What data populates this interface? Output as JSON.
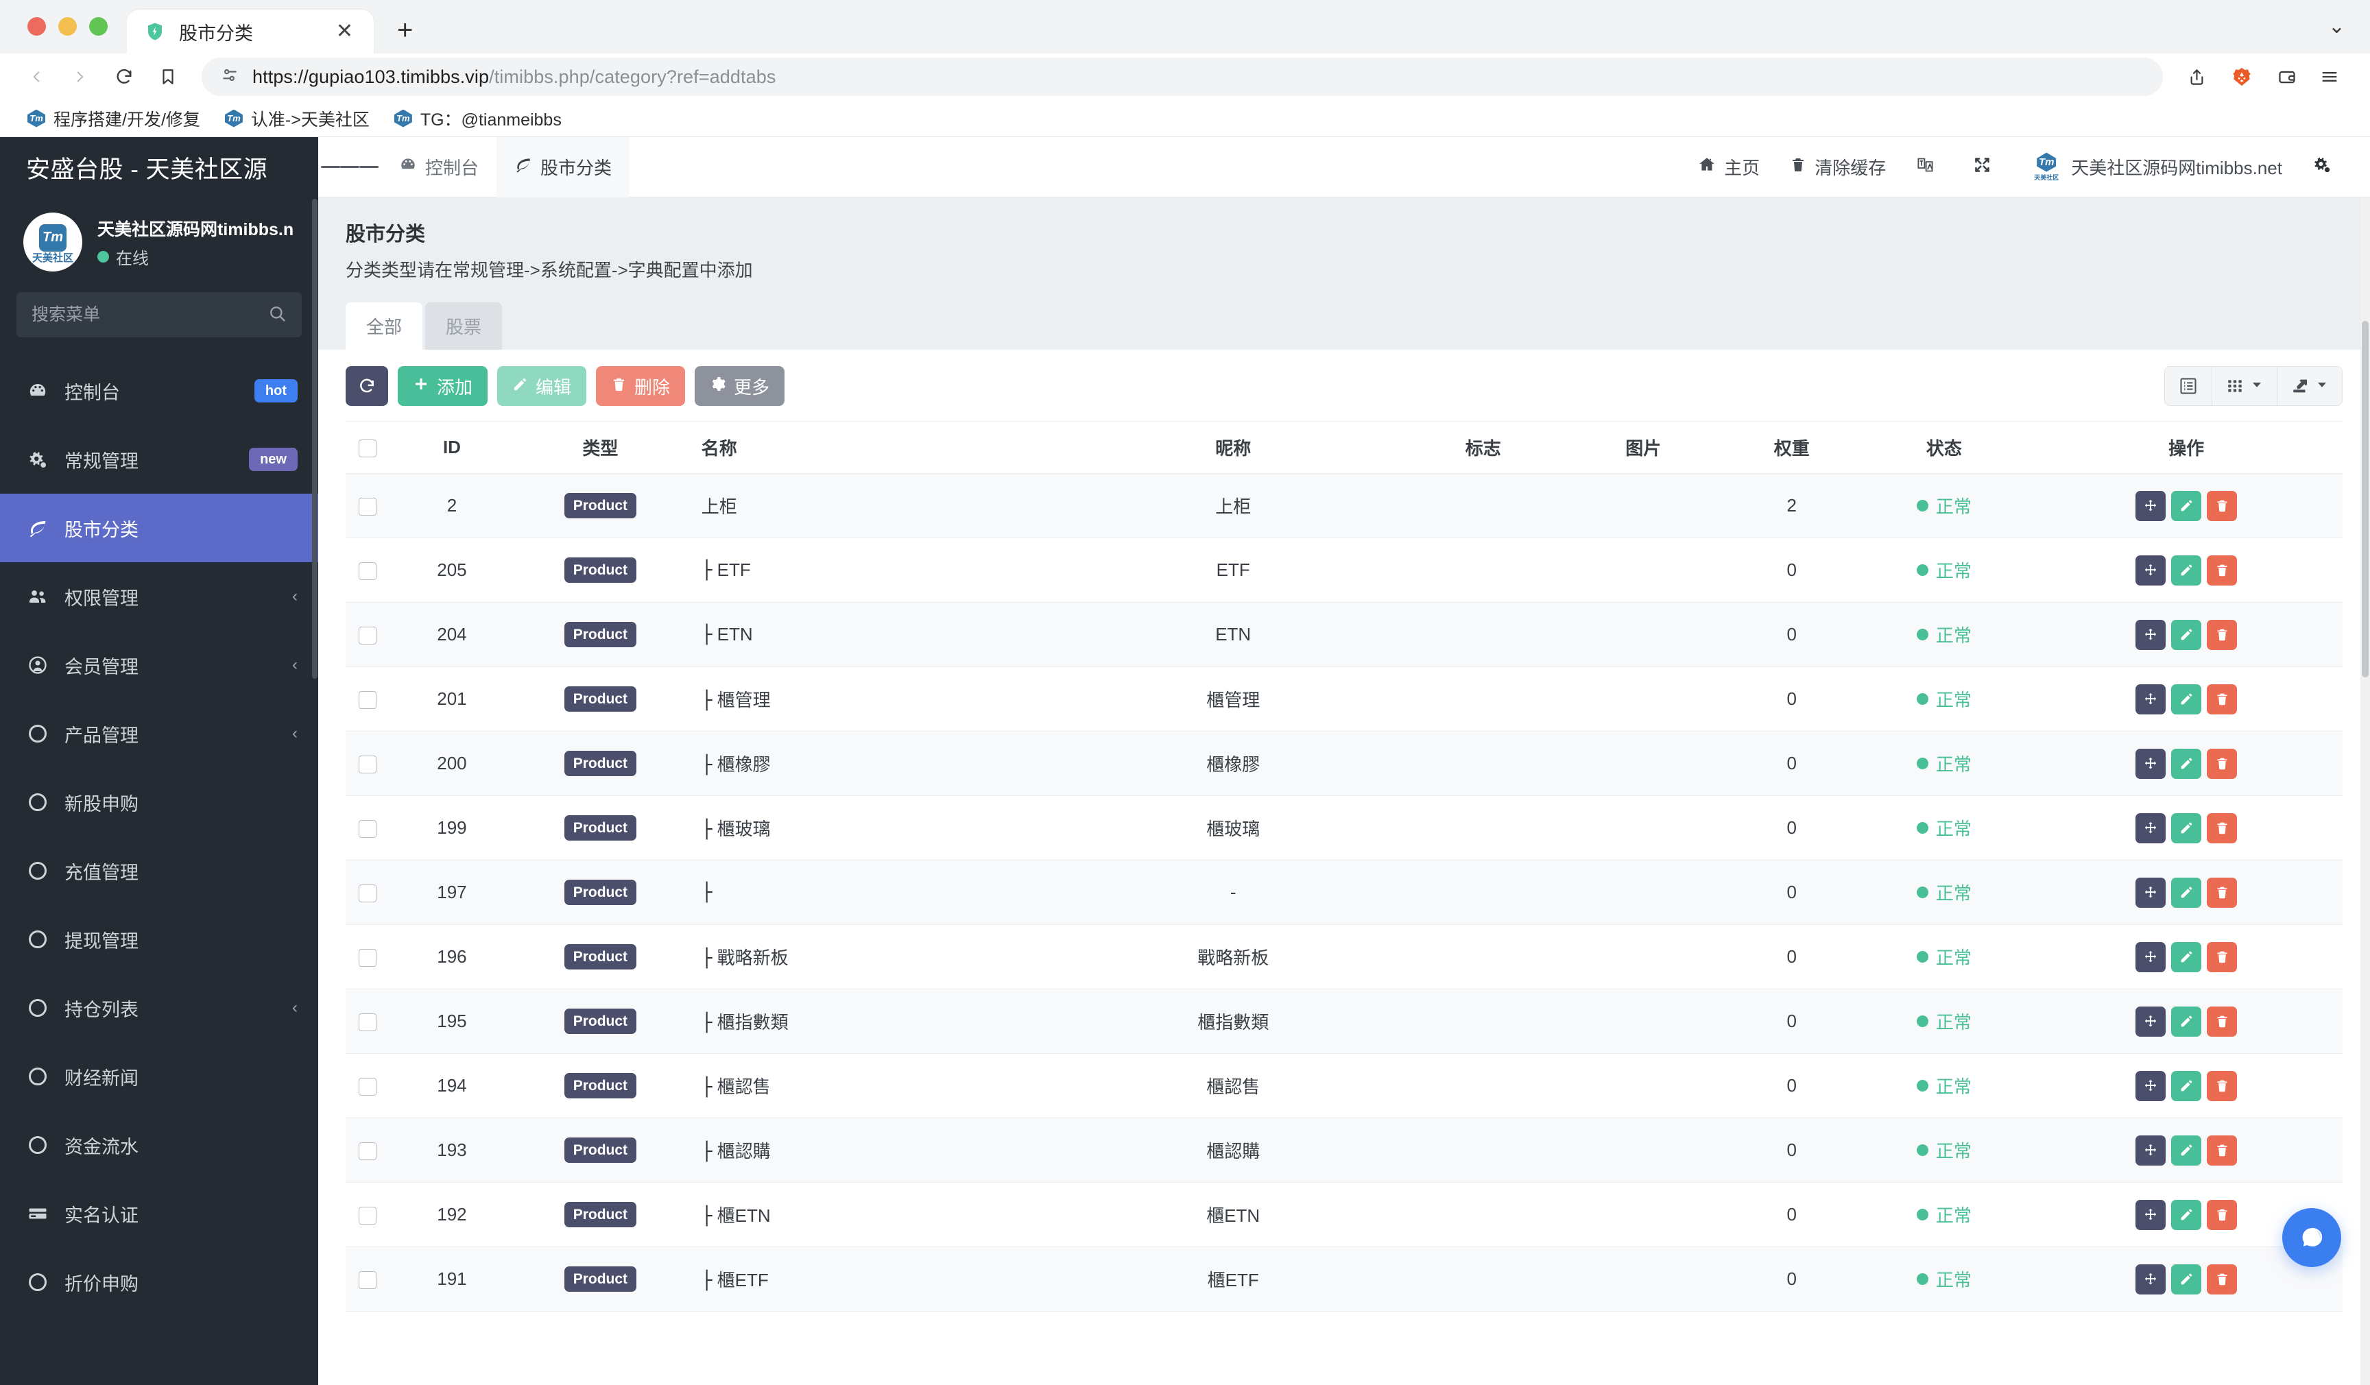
{
  "browser": {
    "tab": {
      "title": "股市分类",
      "favicon": "brave-shield-icon",
      "close_label": "✕"
    },
    "new_tab_label": "+",
    "url_scheme_host": "https://gupiao103.timibbs.vip",
    "url_path": "/timibbs.php/category?ref=addtabs",
    "url_full": "https://gupiao103.timibbs.vip/timibbs.php/category?ref=addtabs",
    "bookmarks": [
      {
        "label": "程序搭建/开发/修复",
        "icon": "timibbs-icon"
      },
      {
        "label": "认准->天美社区",
        "icon": "timibbs-icon"
      },
      {
        "label": "TG：@tianmeibbs",
        "icon": "timibbs-icon"
      }
    ]
  },
  "sidebar": {
    "brand": "安盛台股 - 天美社区源",
    "user": {
      "name": "天美社区源码网timibbs.n",
      "status": "在线",
      "avatar_text": "Tm",
      "avatar_sub": "天美社区"
    },
    "search": {
      "placeholder": "搜索菜单",
      "value": ""
    },
    "items": [
      {
        "label": "控制台",
        "icon": "dashboard-icon",
        "badge": "hot",
        "badge_type": "hot",
        "active": false,
        "caret": false
      },
      {
        "label": "常规管理",
        "icon": "cogs-icon",
        "badge": "new",
        "badge_type": "new",
        "active": false,
        "caret": false
      },
      {
        "label": "股市分类",
        "icon": "leaf-icon",
        "badge": "",
        "active": true,
        "caret": false
      },
      {
        "label": "权限管理",
        "icon": "users-icon",
        "badge": "",
        "active": false,
        "caret": true
      },
      {
        "label": "会员管理",
        "icon": "user-circle-icon",
        "badge": "",
        "active": false,
        "caret": true
      },
      {
        "label": "产品管理",
        "icon": "circle-icon",
        "badge": "",
        "active": false,
        "caret": true
      },
      {
        "label": "新股申购",
        "icon": "circle-icon",
        "badge": "",
        "active": false,
        "caret": false
      },
      {
        "label": "充值管理",
        "icon": "circle-icon",
        "badge": "",
        "active": false,
        "caret": false
      },
      {
        "label": "提现管理",
        "icon": "circle-icon",
        "badge": "",
        "active": false,
        "caret": false
      },
      {
        "label": "持仓列表",
        "icon": "circle-icon",
        "badge": "",
        "active": false,
        "caret": true
      },
      {
        "label": "财经新闻",
        "icon": "circle-icon",
        "badge": "",
        "active": false,
        "caret": false
      },
      {
        "label": "资金流水",
        "icon": "circle-icon",
        "badge": "",
        "active": false,
        "caret": false
      },
      {
        "label": "实名认证",
        "icon": "id-card-icon",
        "badge": "",
        "active": false,
        "caret": false
      },
      {
        "label": "折价申购",
        "icon": "circle-icon",
        "badge": "",
        "active": false,
        "caret": false
      }
    ]
  },
  "topbar": {
    "menu_toggle": "hamburger-icon",
    "tabs": [
      {
        "label": "控制台",
        "icon": "dashboard-icon",
        "active": false
      },
      {
        "label": "股市分类",
        "icon": "leaf-icon",
        "active": true
      }
    ],
    "right": [
      {
        "label": "主页",
        "icon": "home-icon"
      },
      {
        "label": "清除缓存",
        "icon": "trash-icon"
      },
      {
        "label": "",
        "icon": "language-icon"
      },
      {
        "label": "",
        "icon": "fullscreen-icon"
      }
    ],
    "account": {
      "label": "天美社区源码网timibbs.net",
      "avatar_text": "Tm",
      "avatar_sub": "天美社区"
    },
    "settings_icon": "cogs-icon"
  },
  "main": {
    "title": "股市分类",
    "subtitle": "分类类型请在常规管理->系统配置->字典配置中添加",
    "tabs": [
      {
        "label": "全部",
        "active": true
      },
      {
        "label": "股票",
        "active": false
      }
    ],
    "toolbar": {
      "refresh_label": "",
      "add_label": "添加",
      "edit_label": "编辑",
      "delete_label": "删除",
      "more_label": "更多"
    },
    "toolbar_right": [
      {
        "icon": "list-view-icon",
        "caret": false
      },
      {
        "icon": "grid-columns-icon",
        "caret": true
      },
      {
        "icon": "export-icon",
        "caret": true
      }
    ],
    "table": {
      "columns": [
        "",
        "ID",
        "类型",
        "名称",
        "昵称",
        "标志",
        "图片",
        "权重",
        "状态",
        "操作"
      ],
      "row_actions": [
        {
          "icon": "move-icon",
          "kind": "move"
        },
        {
          "icon": "pencil-icon",
          "kind": "pen"
        },
        {
          "icon": "trash-icon",
          "kind": "bin"
        }
      ],
      "rows": [
        {
          "id": "2",
          "type": "Product",
          "name": "上柜",
          "prefix": "",
          "nickname": "上柜",
          "flag": "",
          "image": "",
          "weight": "2",
          "status": "正常"
        },
        {
          "id": "205",
          "type": "Product",
          "name": "ETF",
          "prefix": "├",
          "nickname": "ETF",
          "flag": "",
          "image": "",
          "weight": "0",
          "status": "正常"
        },
        {
          "id": "204",
          "type": "Product",
          "name": "ETN",
          "prefix": "├",
          "nickname": "ETN",
          "flag": "",
          "image": "",
          "weight": "0",
          "status": "正常"
        },
        {
          "id": "201",
          "type": "Product",
          "name": "櫃管理",
          "prefix": "├",
          "nickname": "櫃管理",
          "flag": "",
          "image": "",
          "weight": "0",
          "status": "正常"
        },
        {
          "id": "200",
          "type": "Product",
          "name": "櫃橡膠",
          "prefix": "├",
          "nickname": "櫃橡膠",
          "flag": "",
          "image": "",
          "weight": "0",
          "status": "正常"
        },
        {
          "id": "199",
          "type": "Product",
          "name": "櫃玻璃",
          "prefix": "├",
          "nickname": "櫃玻璃",
          "flag": "",
          "image": "",
          "weight": "0",
          "status": "正常"
        },
        {
          "id": "197",
          "type": "Product",
          "name": "",
          "prefix": "├",
          "nickname": "-",
          "flag": "",
          "image": "",
          "weight": "0",
          "status": "正常"
        },
        {
          "id": "196",
          "type": "Product",
          "name": "戰略新板",
          "prefix": "├",
          "nickname": "戰略新板",
          "flag": "",
          "image": "",
          "weight": "0",
          "status": "正常"
        },
        {
          "id": "195",
          "type": "Product",
          "name": "櫃指數類",
          "prefix": "├",
          "nickname": "櫃指數類",
          "flag": "",
          "image": "",
          "weight": "0",
          "status": "正常"
        },
        {
          "id": "194",
          "type": "Product",
          "name": "櫃認售",
          "prefix": "├",
          "nickname": "櫃認售",
          "flag": "",
          "image": "",
          "weight": "0",
          "status": "正常"
        },
        {
          "id": "193",
          "type": "Product",
          "name": "櫃認購",
          "prefix": "├",
          "nickname": "櫃認購",
          "flag": "",
          "image": "",
          "weight": "0",
          "status": "正常"
        },
        {
          "id": "192",
          "type": "Product",
          "name": "櫃ETN",
          "prefix": "├",
          "nickname": "櫃ETN",
          "flag": "",
          "image": "",
          "weight": "0",
          "status": "正常"
        },
        {
          "id": "191",
          "type": "Product",
          "name": "櫃ETF",
          "prefix": "├",
          "nickname": "櫃ETF",
          "flag": "",
          "image": "",
          "weight": "0",
          "status": "正常"
        }
      ]
    },
    "chat_fab": "chat-bubble-icon"
  },
  "colors": {
    "accent_primary": "#5c6bc7",
    "sidebar_bg": "#242b33",
    "success": "#48bf98",
    "danger": "#ef8878",
    "chip": "#4c4f6b",
    "badge_hot": "#3d7ff0",
    "badge_new": "#6c68b5",
    "chat_fab": "#3b7ef0"
  }
}
